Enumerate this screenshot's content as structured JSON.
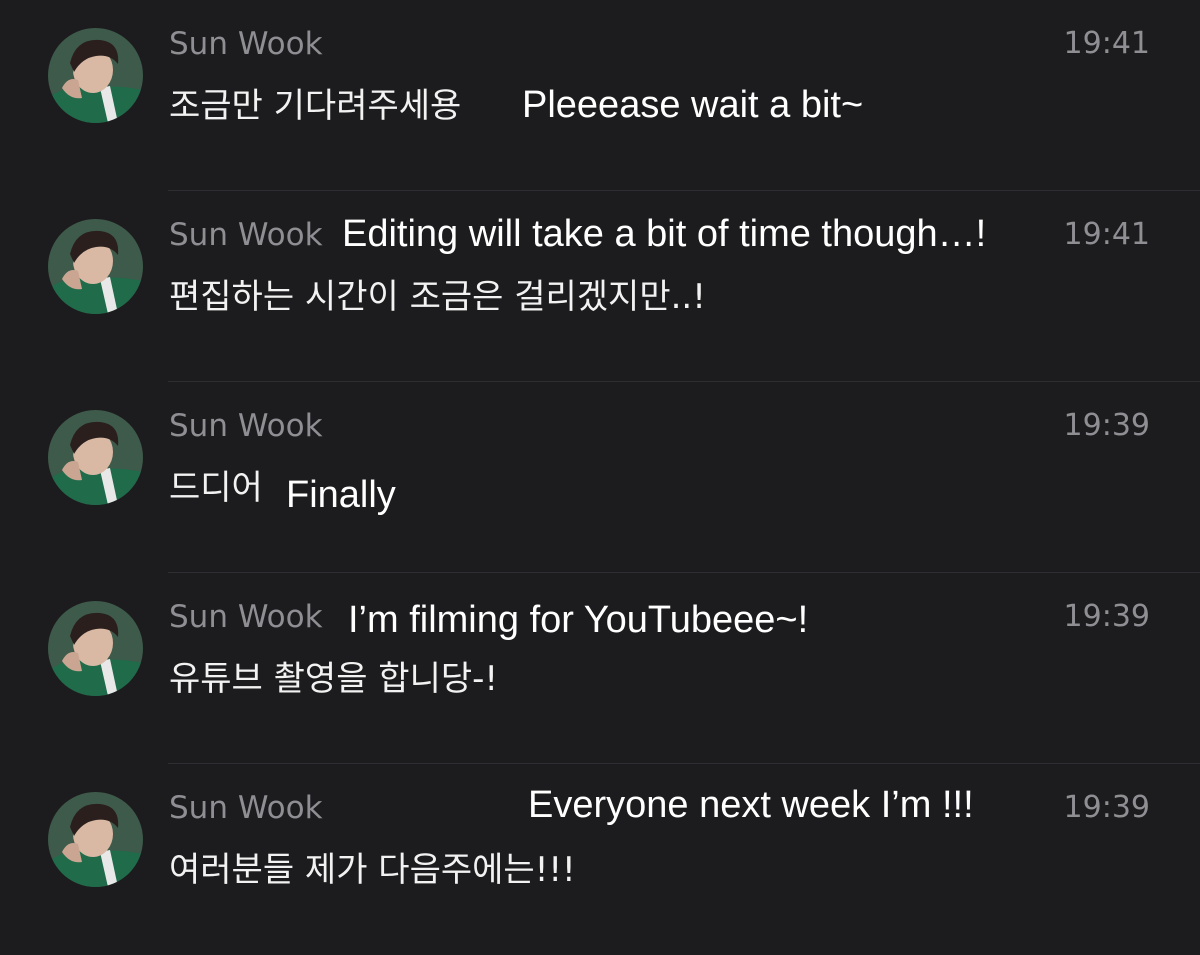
{
  "messages": [
    {
      "sender": "Sun Wook",
      "time": "19:41",
      "text": "조금만 기다려주세용",
      "translation": "Pleeease wait a bit~"
    },
    {
      "sender": "Sun Wook",
      "time": "19:41",
      "text": "편집하는 시간이 조금은 걸리겠지만..!",
      "translation": "Editing will take a bit of time though…!"
    },
    {
      "sender": "Sun Wook",
      "time": "19:39",
      "text": "드디어",
      "translation": "Finally"
    },
    {
      "sender": "Sun Wook",
      "time": "19:39",
      "text": "유튜브 촬영을 합니당-!",
      "translation": "I’m filming for YouTubeee~!"
    },
    {
      "sender": "Sun Wook",
      "time": "19:39",
      "text": "여러분들 제가 다음주에는!!!",
      "translation": "Everyone next week I’m !!!"
    }
  ],
  "icons": {
    "avatar": "profile-photo-icon"
  },
  "colors": {
    "background": "#1c1c1e",
    "meta_text": "#8e8e93",
    "message_text": "#f2f2f2",
    "translation_text": "#ffffff",
    "divider": "#2e2e32"
  }
}
